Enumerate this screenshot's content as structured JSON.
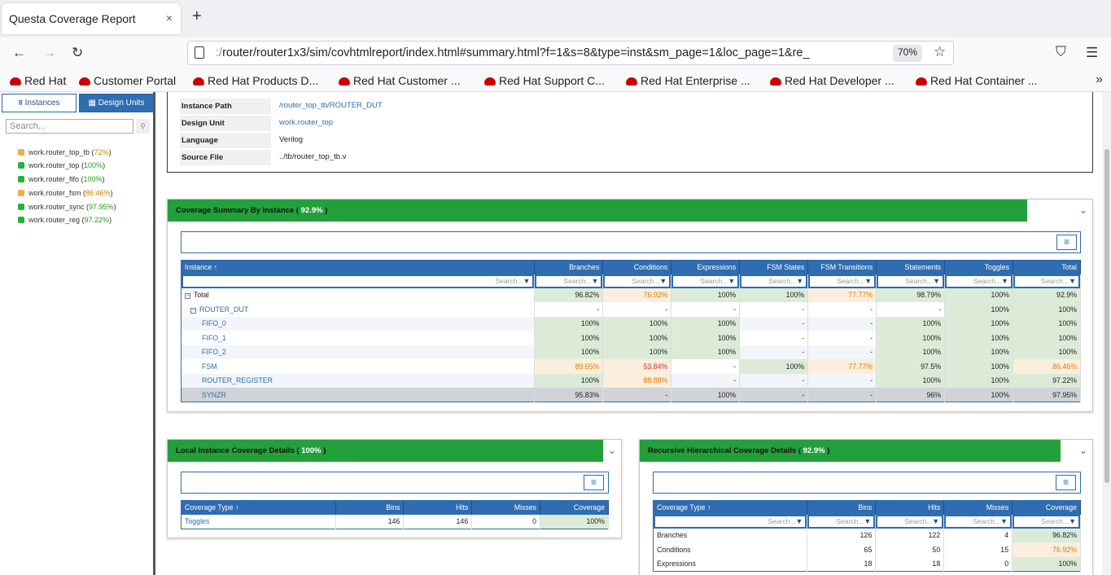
{
  "browser": {
    "tab_title": "Questa Coverage Report",
    "tab_close": "×",
    "new_tab": "+",
    "url_dim": ":/",
    "url_main": "router/router1x3/sim/covhtmlreport/index.html#summary.html?f=1&s=8&type=inst&sm_page=1&loc_page=1&re_",
    "zoom": "70%",
    "bookmarks": [
      "Red Hat",
      "Customer Portal",
      "Red Hat Products D...",
      "Red Hat Customer ...",
      "Red Hat Support C...",
      "Red Hat Enterprise ...",
      "Red Hat Developer ...",
      "Red Hat Container ..."
    ],
    "more": "»"
  },
  "sidebar": {
    "tab_instances": "Instances",
    "tab_design_units": "Design Units",
    "search_placeholder": "Search...",
    "items": [
      {
        "name": "work.router_top_tb",
        "pct": "72%",
        "color": "#f0ad4e"
      },
      {
        "name": "work.router_top",
        "pct": "100%",
        "color": "#22b33a"
      },
      {
        "name": "work.router_fifo",
        "pct": "100%",
        "color": "#22b33a"
      },
      {
        "name": "work.router_fsm",
        "pct": "86.46%",
        "color": "#f0ad4e"
      },
      {
        "name": "work.router_sync",
        "pct": "97.95%",
        "color": "#22b33a"
      },
      {
        "name": "work.router_reg",
        "pct": "97.22%",
        "color": "#22b33a"
      }
    ]
  },
  "info": {
    "instance_path_label": "Instance Path",
    "instance_path": "/router_top_tb/ROUTER_DUT",
    "design_unit_label": "Design Unit",
    "design_unit": "work.router_top",
    "language_label": "Language",
    "language": "Verilog",
    "source_file_label": "Source File",
    "source_file": "../tb/router_top_tb.v"
  },
  "summary": {
    "title": "Coverage Summary By Instance",
    "badge": "92.9%",
    "columns": [
      "Instance ↑",
      "Branches",
      "Conditions",
      "Expressions",
      "FSM States",
      "FSM Transitions",
      "Statements",
      "Toggles",
      "Total"
    ],
    "filter_placeholder": "Search...",
    "rows": [
      {
        "name": "Total",
        "cells": [
          "96.82%",
          "76.92%",
          "100%",
          "100%",
          "77.77%",
          "98.79%",
          "100%",
          "92.9%"
        ]
      },
      {
        "name": "ROUTER_DUT",
        "cells": [
          "-",
          "-",
          "-",
          "-",
          "-",
          "-",
          "100%",
          "100%"
        ]
      },
      {
        "name": "FIFO_0",
        "cells": [
          "100%",
          "100%",
          "100%",
          "-",
          "-",
          "100%",
          "100%",
          "100%"
        ]
      },
      {
        "name": "FIFO_1",
        "cells": [
          "100%",
          "100%",
          "100%",
          "-",
          "-",
          "100%",
          "100%",
          "100%"
        ]
      },
      {
        "name": "FIFO_2",
        "cells": [
          "100%",
          "100%",
          "100%",
          "-",
          "-",
          "100%",
          "100%",
          "100%"
        ]
      },
      {
        "name": "FSM",
        "cells": [
          "89.65%",
          "53.84%",
          "-",
          "100%",
          "77.77%",
          "97.5%",
          "100%",
          "86.46%"
        ]
      },
      {
        "name": "ROUTER_REGISTER",
        "cells": [
          "100%",
          "88.88%",
          "-",
          "-",
          "-",
          "100%",
          "100%",
          "97.22%"
        ]
      },
      {
        "name": "SYNZR",
        "cells": [
          "95.83%",
          "-",
          "100%",
          "-",
          "-",
          "96%",
          "100%",
          "97.95%"
        ]
      }
    ]
  },
  "local": {
    "title": "Local Instance Coverage Details",
    "badge": "100%",
    "columns": [
      "Coverage Type ↑",
      "Bins",
      "Hits",
      "Misses",
      "Coverage"
    ],
    "rows": [
      {
        "type": "Toggles",
        "bins": "146",
        "hits": "146",
        "misses": "0",
        "coverage": "100%"
      }
    ]
  },
  "recursive": {
    "title": "Recursive Hierarchical Coverage Details",
    "badge": "92.9%",
    "columns": [
      "Coverage Type ↑",
      "Bins",
      "Hits",
      "Misses",
      "Coverage"
    ],
    "filter_placeholder": "Search...",
    "rows": [
      {
        "type": "Branches",
        "bins": "126",
        "hits": "122",
        "misses": "4",
        "coverage": "96.82%"
      },
      {
        "type": "Conditions",
        "bins": "65",
        "hits": "50",
        "misses": "15",
        "coverage": "76.92%"
      },
      {
        "type": "Expressions",
        "bins": "18",
        "hits": "18",
        "misses": "0",
        "coverage": "100%"
      }
    ]
  }
}
